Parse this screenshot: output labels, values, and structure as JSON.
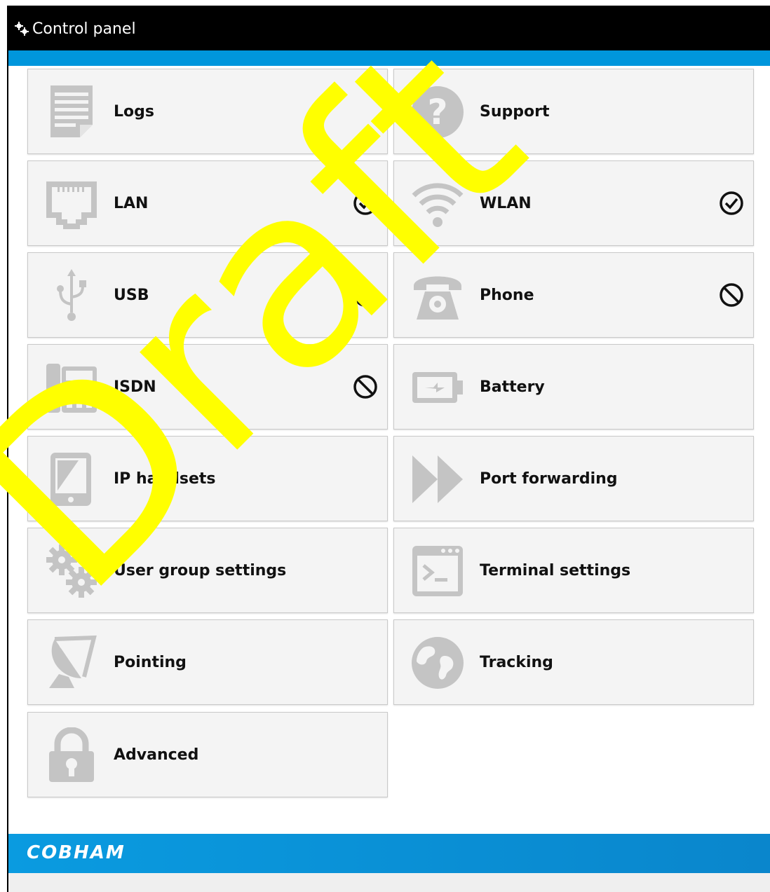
{
  "window": {
    "title": "Control panel"
  },
  "tiles": [
    {
      "label": "Logs",
      "icon": "document-icon"
    },
    {
      "label": "Support",
      "icon": "question-icon"
    },
    {
      "label": "LAN",
      "icon": "ethernet-port-icon",
      "status": "ok"
    },
    {
      "label": "WLAN",
      "icon": "wifi-icon",
      "status": "ok"
    },
    {
      "label": "USB",
      "icon": "usb-icon",
      "status": "disabled"
    },
    {
      "label": "Phone",
      "icon": "phone-icon",
      "status": "disabled"
    },
    {
      "label": "ISDN",
      "icon": "isdn-phone-icon",
      "status": "disabled"
    },
    {
      "label": "Battery",
      "icon": "battery-icon"
    },
    {
      "label": "IP handsets",
      "icon": "handset-icon"
    },
    {
      "label": "Port forwarding",
      "icon": "fast-forward-icon"
    },
    {
      "label": "User group settings",
      "icon": "gears-icon"
    },
    {
      "label": "Terminal settings",
      "icon": "terminal-icon"
    },
    {
      "label": "Pointing",
      "icon": "satellite-dish-icon"
    },
    {
      "label": "Tracking",
      "icon": "globe-icon"
    },
    {
      "label": "Advanced",
      "icon": "lock-icon"
    }
  ],
  "watermark": "Draft",
  "footer": {
    "logo": "COBHAM"
  },
  "colors": {
    "accent": "#0096dc",
    "titlebar": "#000000",
    "icon": "#c4c4c4",
    "watermark": "#ffff00"
  }
}
